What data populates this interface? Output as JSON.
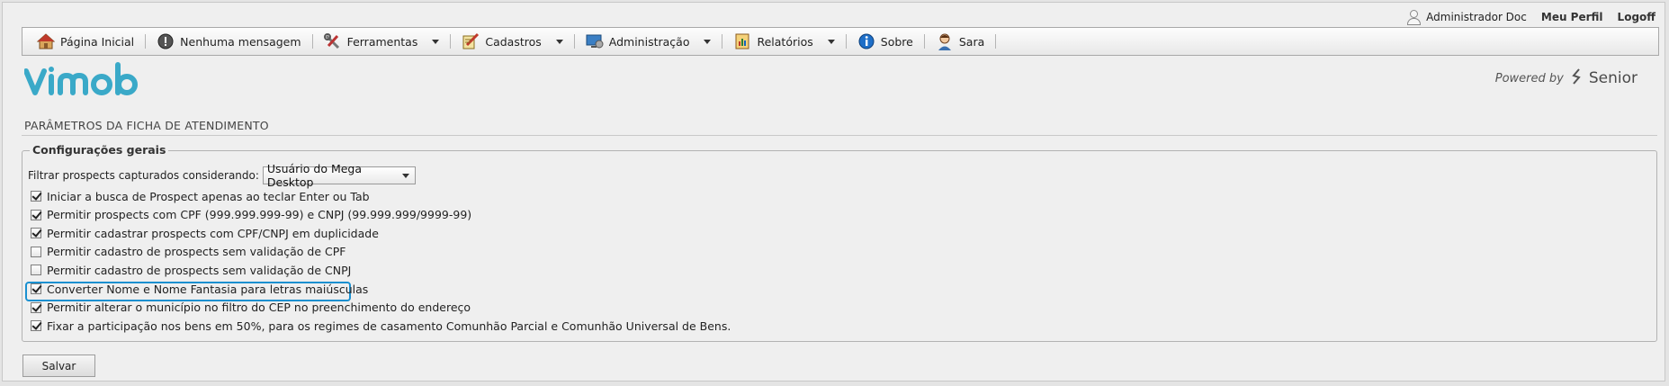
{
  "userbar": {
    "user_name": "Administrador Doc",
    "profile_link": "Meu Perfil",
    "logoff_link": "Logoff"
  },
  "menu": {
    "items": [
      {
        "label": "Página Inicial",
        "icon": "home-icon",
        "dropdown": false
      },
      {
        "label": "Nenhuma mensagem",
        "icon": "info-alert-icon",
        "dropdown": false
      },
      {
        "label": "Ferramentas",
        "icon": "tools-icon",
        "dropdown": true
      },
      {
        "label": "Cadastros",
        "icon": "edit-document-icon",
        "dropdown": true
      },
      {
        "label": "Administração",
        "icon": "monitor-settings-icon",
        "dropdown": true
      },
      {
        "label": "Relatórios",
        "icon": "reports-icon",
        "dropdown": true
      },
      {
        "label": "Sobre",
        "icon": "info-circle-icon",
        "dropdown": false
      },
      {
        "label": "Sara",
        "icon": "user-avatar-icon",
        "dropdown": false
      }
    ]
  },
  "branding": {
    "logo_text": "vimob",
    "powered_by": "Powered by",
    "partner": "Senior",
    "logo_color": "#3aa9c8"
  },
  "page": {
    "title": "PARÂMETROS DA FICHA DE ATENDIMENTO"
  },
  "config": {
    "legend": "Configurações gerais",
    "filter_label": "Filtrar prospects capturados considerando:",
    "filter_value": "Usuário do Mega Desktop",
    "options": [
      {
        "label": "Iniciar a busca de Prospect apenas ao teclar Enter ou Tab",
        "checked": true
      },
      {
        "label": "Permitir prospects com CPF (999.999.999-99) e CNPJ (99.999.999/9999-99)",
        "checked": true
      },
      {
        "label": "Permitir cadastrar prospects com CPF/CNPJ em duplicidade",
        "checked": true
      },
      {
        "label": "Permitir cadastro de prospects sem validação de CPF",
        "checked": false
      },
      {
        "label": "Permitir cadastro de prospects sem validação de CNPJ",
        "checked": false
      },
      {
        "label": "Converter Nome e Nome Fantasia para letras maiúsculas",
        "checked": true,
        "highlighted": true
      },
      {
        "label": "Permitir alterar o município no filtro do CEP no preenchimento do endereço",
        "checked": true
      },
      {
        "label": "Fixar a participação nos bens em 50%, para os regimes de casamento Comunhão Parcial e Comunhão Universal de Bens.",
        "checked": true
      }
    ]
  },
  "actions": {
    "save_label": "Salvar"
  },
  "colors": {
    "highlight": "#1a90d0"
  }
}
